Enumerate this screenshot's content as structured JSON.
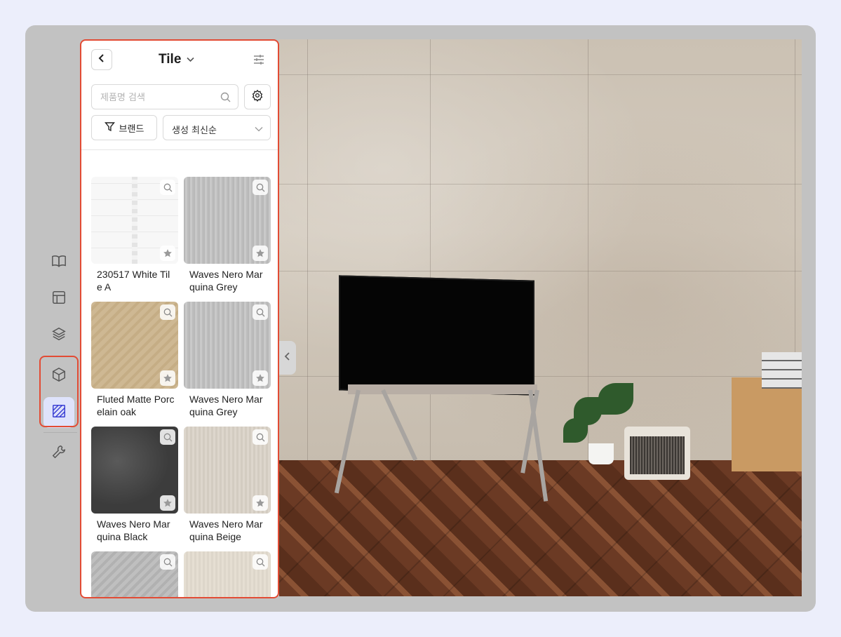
{
  "panel": {
    "title": "Tile",
    "search_placeholder": "제품명 검색",
    "brand_label": "브랜드",
    "sort_label": "생성 최신순"
  },
  "items": [
    {
      "name": "230517 White Tile A",
      "texture": "white"
    },
    {
      "name": "Waves Nero Marquina Grey",
      "texture": "grey"
    },
    {
      "name": "Fluted Matte Porcelain oak",
      "texture": "oak"
    },
    {
      "name": "Waves Nero Marquina Grey",
      "texture": "grey"
    },
    {
      "name": "Waves Nero Marquina Black",
      "texture": "black"
    },
    {
      "name": "Waves Nero Marquina Beige",
      "texture": "beige"
    },
    {
      "name": "",
      "texture": "grey2"
    },
    {
      "name": "",
      "texture": "beige2"
    }
  ],
  "rail": {
    "items": [
      "book-icon",
      "layout-icon",
      "layers-icon",
      "cube-icon",
      "material-icon",
      "wrench-icon"
    ],
    "active": "material-icon"
  },
  "colors": {
    "highlight": "#e24b34",
    "active_rail_bg": "#dfe3fb",
    "active_rail_icon": "#3a3fd4"
  }
}
